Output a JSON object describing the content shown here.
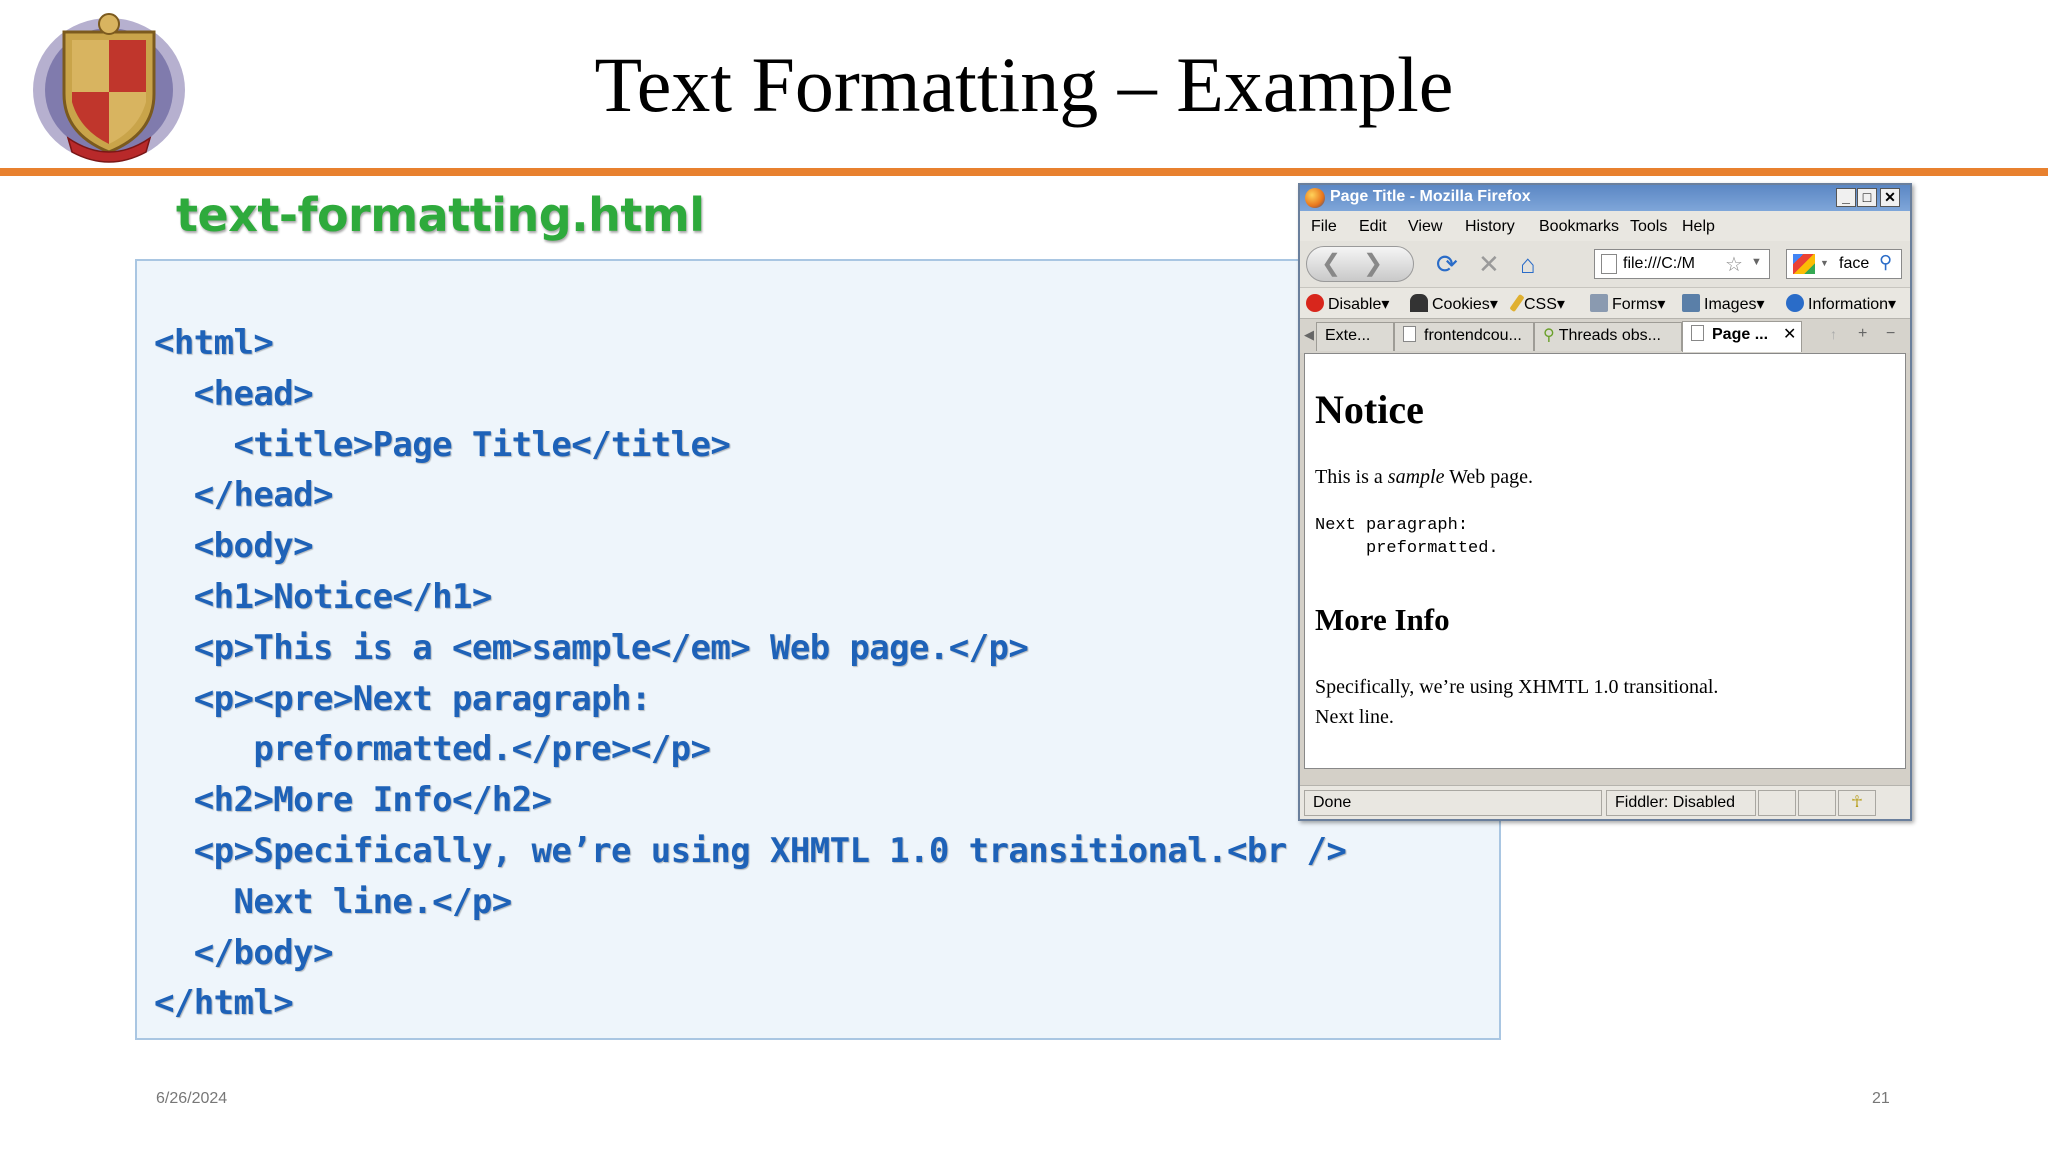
{
  "slide": {
    "title": "Text Formatting – Example",
    "file_caption": "text-formatting.html",
    "date": "6/26/2024",
    "page_number": "21",
    "accent_color": "#e8812f",
    "caption_color": "#2eaa3c",
    "code_color": "#1e62b8"
  },
  "code": {
    "lines": [
      "<html>",
      "  <head>",
      "    <title>Page Title</title>",
      "  </head>",
      "  <body>",
      "  <h1>Notice</h1>",
      "  <p>This is a <em>sample</em> Web page.</p>",
      "  <p><pre>Next paragraph:",
      "     preformatted.</pre></p>",
      "  <h2>More Info</h2>",
      "  <p>Specifically, we’re using XHMTL 1.0 transitional.<br />",
      "    Next line.</p>",
      "  </body>",
      "</html>"
    ]
  },
  "browser": {
    "window_title": "Page Title - Mozilla Firefox",
    "window_buttons": {
      "minimize": "_",
      "maximize": "□",
      "close": "✕"
    },
    "menu": [
      "File",
      "Edit",
      "View",
      "History",
      "Bookmarks",
      "Tools",
      "Help"
    ],
    "url": "file:///C:/M",
    "search_text": "face",
    "devbar": [
      "Disable",
      "Cookies",
      "CSS",
      "Forms",
      "Images",
      "Information"
    ],
    "tabs": [
      {
        "label": "Exte..."
      },
      {
        "label": "frontendcou..."
      },
      {
        "label": "Threads obs..."
      },
      {
        "label": "Page ..."
      }
    ],
    "tab_close": "✕",
    "content": {
      "h1": "Notice",
      "p1_before": "This is a ",
      "p1_em": "sample",
      "p1_after": " Web page.",
      "pre": "Next paragraph:\n     preformatted.",
      "h2": "More Info",
      "p2_line1": "Specifically, we’re using XHMTL 1.0 transitional.",
      "p2_line2": "Next line."
    },
    "status": {
      "left": "Done",
      "fiddler": "Fiddler: Disabled"
    }
  }
}
